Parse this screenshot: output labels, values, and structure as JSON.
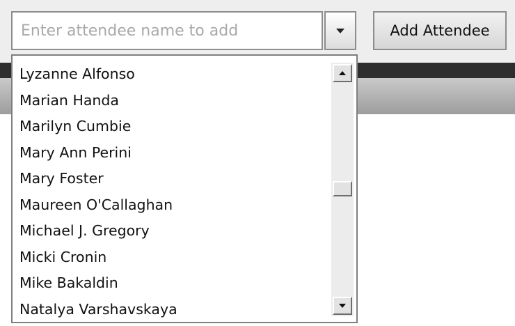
{
  "attendee_picker": {
    "input_value": "",
    "input_placeholder": "Enter attendee name to add",
    "dropdown_icon": "chevron-down-icon",
    "add_button_label": "Add Attendee"
  },
  "dropdown": {
    "items": [
      "Lyzanne Alfonso",
      "Marian Handa",
      "Marilyn Cumbie",
      "Mary Ann Perini",
      "Mary Foster",
      "Maureen O'Callaghan",
      "Michael J. Gregory",
      "Micki Cronin",
      "Mike Bakaldin",
      "Natalya Varshavskaya"
    ]
  },
  "colors": {
    "dark_bar": "#2e2e2e",
    "grey_bar": "#b3b3b3",
    "border": "#8d8d8d"
  }
}
